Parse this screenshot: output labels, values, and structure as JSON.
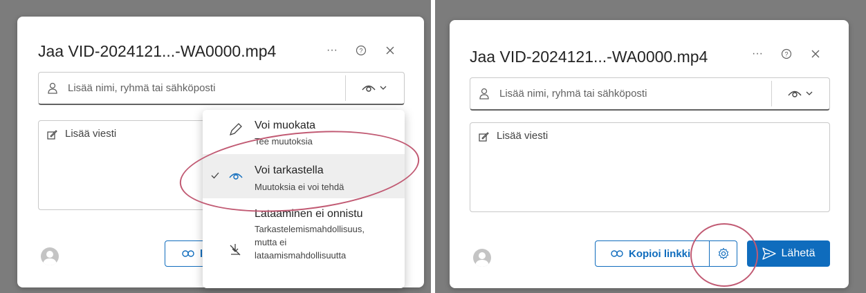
{
  "left": {
    "dialog": {
      "title": "Jaa VID-2024121...-WA0000.mp4",
      "recipient_placeholder": "Lisää nimi, ryhmä tai sähköposti",
      "message_placeholder": "Lisää viesti",
      "copy_label_fragment": "l"
    },
    "permission_menu": {
      "items": [
        {
          "title": "Voi muokata",
          "subtitle": "Tee muutoksia",
          "icon": "pencil-icon",
          "selected": false
        },
        {
          "title": "Voi tarkastella",
          "subtitle": "Muutoksia ei voi tehdä",
          "icon": "eye-icon",
          "selected": true
        },
        {
          "title": "Lataaminen ei onnistu",
          "subtitle_lines": [
            "Tarkastelemismahdollisuus,",
            "mutta ei",
            "lataamismahdollisuutta"
          ],
          "icon": "no-download-icon",
          "selected": false
        }
      ]
    }
  },
  "right": {
    "dialog": {
      "title": "Jaa VID-2024121...-WA0000.mp4",
      "recipient_placeholder": "Lisää nimi, ryhmä tai sähköposti",
      "message_placeholder": "Lisää viesti",
      "copy_link_label": "Kopioi linkki",
      "send_label": "Lähetä"
    }
  },
  "colors": {
    "accent": "#0f6cbd",
    "annotation": "#c15a73",
    "backdrop": "#7c7c7c"
  }
}
